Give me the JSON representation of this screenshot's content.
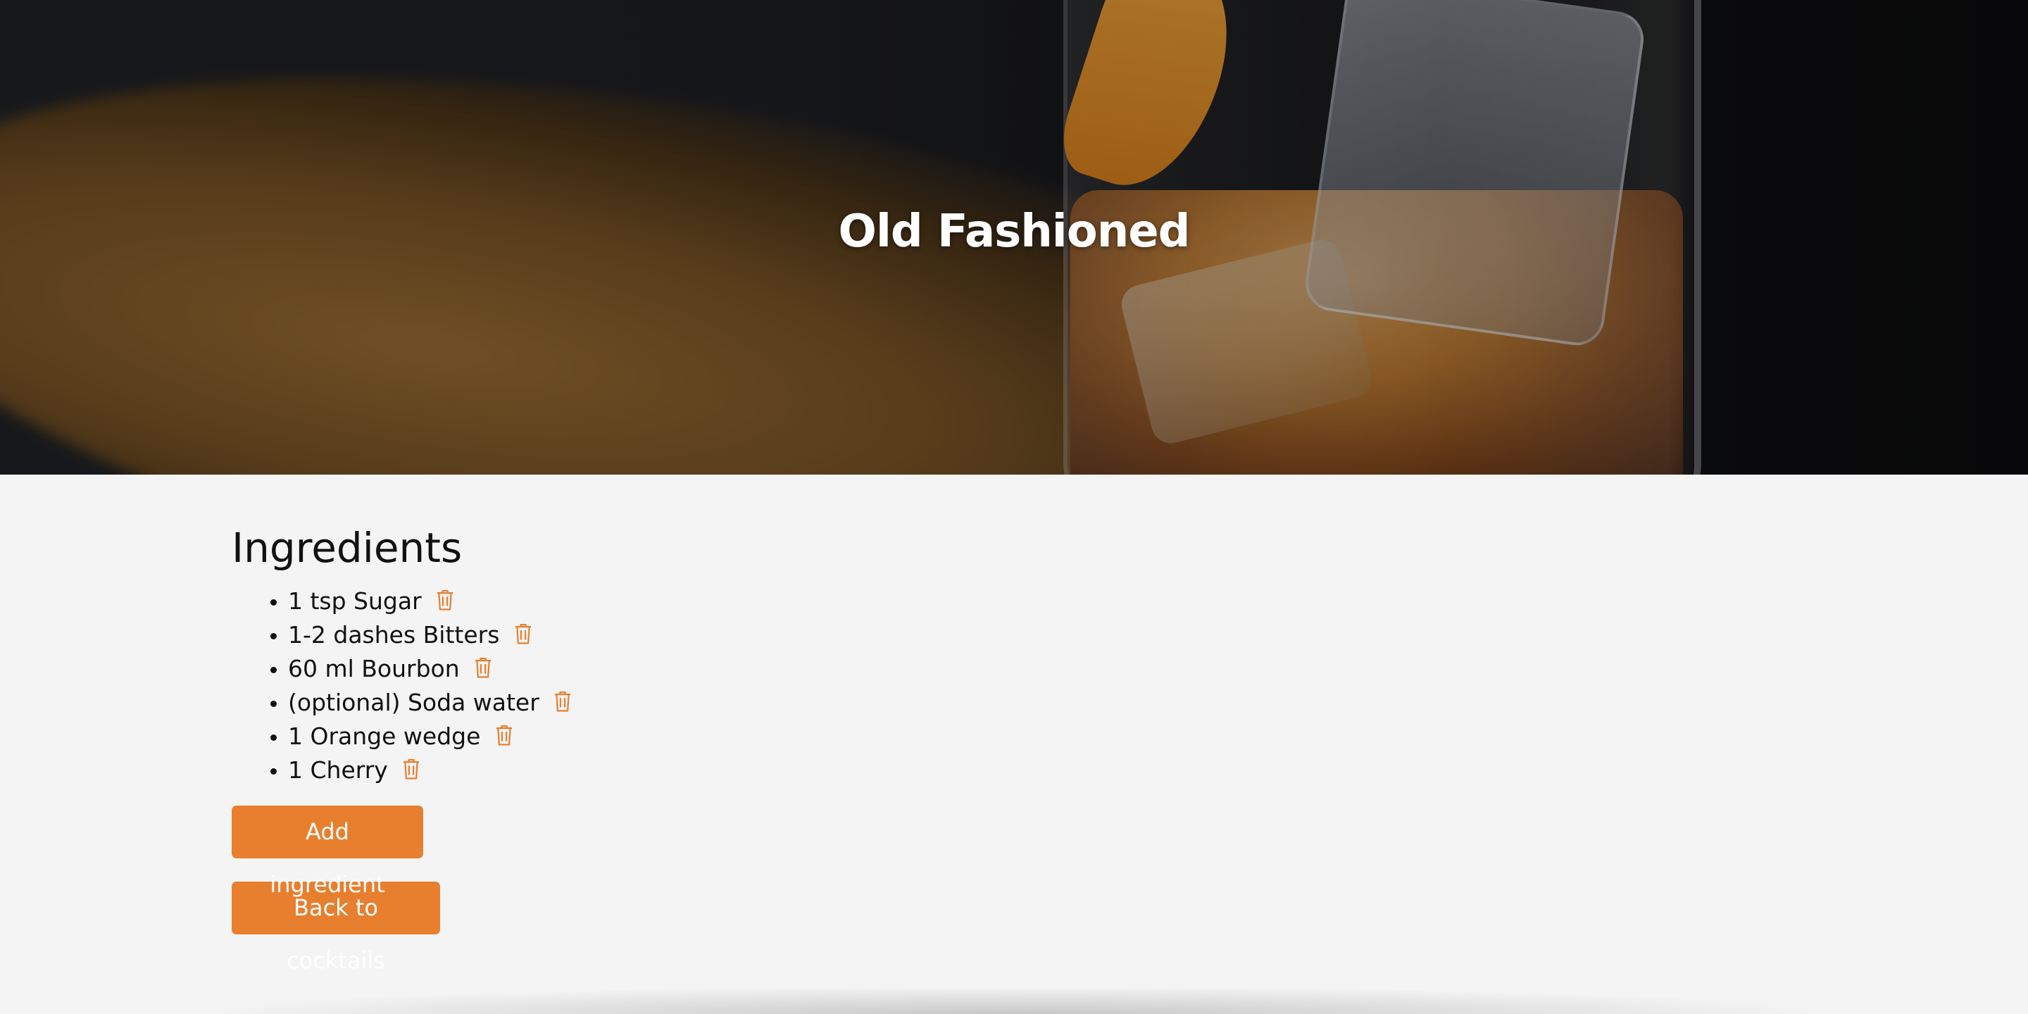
{
  "hero": {
    "title": "Old Fashioned"
  },
  "ingredients_section": {
    "heading": "Ingredients",
    "items": [
      {
        "label": "1 tsp Sugar",
        "icon": "trash-icon"
      },
      {
        "label": "1-2 dashes Bitters",
        "icon": "trash-icon"
      },
      {
        "label": "60 ml Bourbon",
        "icon": "trash-icon"
      },
      {
        "label": "(optional) Soda water",
        "icon": "trash-icon"
      },
      {
        "label": "1 Orange wedge",
        "icon": "trash-icon"
      },
      {
        "label": "1 Cherry",
        "icon": "trash-icon"
      }
    ]
  },
  "actions": {
    "add_label": "Add ingredient",
    "back_label": "Back to cocktails"
  },
  "colors": {
    "accent": "#e87f2f",
    "page_background": "#f4f4f4",
    "hero_text": "#ffffff"
  }
}
